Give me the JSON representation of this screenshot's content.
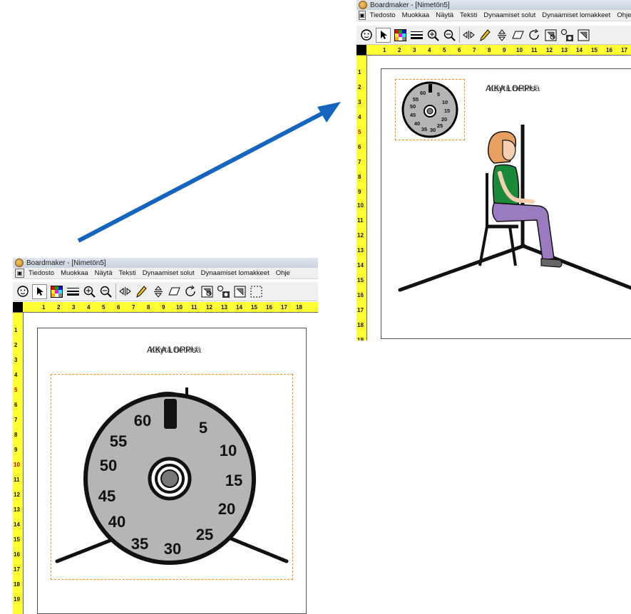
{
  "window": {
    "title": "Boardmaker - [Nimetön5]",
    "menu": [
      "Tiedosto",
      "Muokkaa",
      "Näytä",
      "Teksti",
      "Dynaamiset solut",
      "Dynaamiset lomakkeet",
      "Ohje"
    ]
  },
  "toolbar_icons": [
    "face-icon",
    "pointer-icon",
    "color-palette-icon",
    "line-thickness-icon",
    "zoom-in-icon",
    "zoom-out-icon",
    "flip-icon",
    "pencil-icon",
    "vertical-flip-icon",
    "eraser-icon",
    "rotate-icon",
    "symbol-finder-icon",
    "symbol-select-icon",
    "frame-icon",
    "dotted-selection-icon"
  ],
  "ruler": {
    "horizontal": [
      "1",
      "2",
      "3",
      "4",
      "5",
      "6",
      "7",
      "8",
      "9",
      "10",
      "11",
      "12",
      "13",
      "14",
      "15",
      "16",
      "17",
      "18"
    ],
    "vertical": [
      "1",
      "2",
      "3",
      "4",
      "5",
      "6",
      "7",
      "8",
      "9",
      "10",
      "11",
      "12",
      "13",
      "14",
      "15",
      "16",
      "17",
      "18",
      "19"
    ]
  },
  "board": {
    "title_overlap_a": "AIKA LOPPU",
    "title_overlap_b": "Käytä hetkisä"
  },
  "timer": {
    "labels": [
      "60",
      "5",
      "10",
      "15",
      "20",
      "25",
      "30",
      "35",
      "40",
      "45",
      "50",
      "55"
    ]
  },
  "colors": {
    "arrow": "#1565c0",
    "ruler": "#ffff33",
    "timer_face": "#b5b5b5",
    "selection_border": "#ff8c1a"
  }
}
